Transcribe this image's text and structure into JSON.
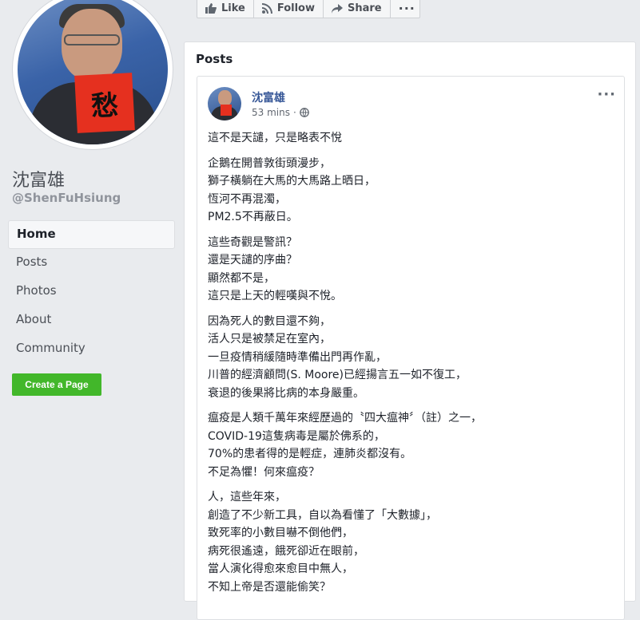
{
  "action_bar": {
    "like_label": "Like",
    "follow_label": "Follow",
    "share_label": "Share",
    "more_label": "···"
  },
  "profile": {
    "avatar_card_text": "愁",
    "name": "沈富雄",
    "handle": "@ShenFuHsiung"
  },
  "nav": {
    "items": [
      {
        "label": "Home"
      },
      {
        "label": "Posts"
      },
      {
        "label": "Photos"
      },
      {
        "label": "About"
      },
      {
        "label": "Community"
      }
    ]
  },
  "create_page_label": "Create a Page",
  "posts_section": {
    "title": "Posts"
  },
  "post": {
    "author": "沈富雄",
    "time": "53 mins",
    "privacy": "globe-icon",
    "more": "···",
    "paragraphs": [
      [
        "這不是天譴，只是略表不悅"
      ],
      [
        "企鵝在開普敦街頭漫步，",
        "獅子橫躺在大馬的大馬路上晒日，",
        "恆河不再混濁，",
        "PM2.5不再蔽日。"
      ],
      [
        "這些奇觀是警訊？",
        "還是天譴的序曲？",
        "顯然都不是，",
        "這只是上天的輕嘆與不悅。"
      ],
      [
        "因為死人的數目還不夠，",
        "活人只是被禁足在室內，",
        "一旦疫情稍緩隨時準備出門再作亂，",
        "川普的經濟顧問(S. Moore)已經揚言五一如不復工，",
        "衰退的後果將比病的本身嚴重。"
      ],
      [
        "瘟疫是人類千萬年來經歷過的〝四大瘟神〞（註）之一，",
        "COVID-19這隻病毒是屬於佛系的，",
        "70%的患者得的是輕症，連肺炎都沒有。",
        "不足為懼！何來瘟疫？"
      ],
      [
        "人，這些年來，",
        "創造了不少新工具，自以為看懂了「大數據」，",
        "致死率的小數目嚇不倒他們，",
        "病死很遙遠，餓死卻近在眼前，",
        "當人演化得愈來愈目中無人，",
        "不知上帝是否還能偷笑？"
      ]
    ]
  },
  "colors": {
    "background": "#e9ebee",
    "link_blue": "#385898",
    "create_green": "#42b72a"
  }
}
